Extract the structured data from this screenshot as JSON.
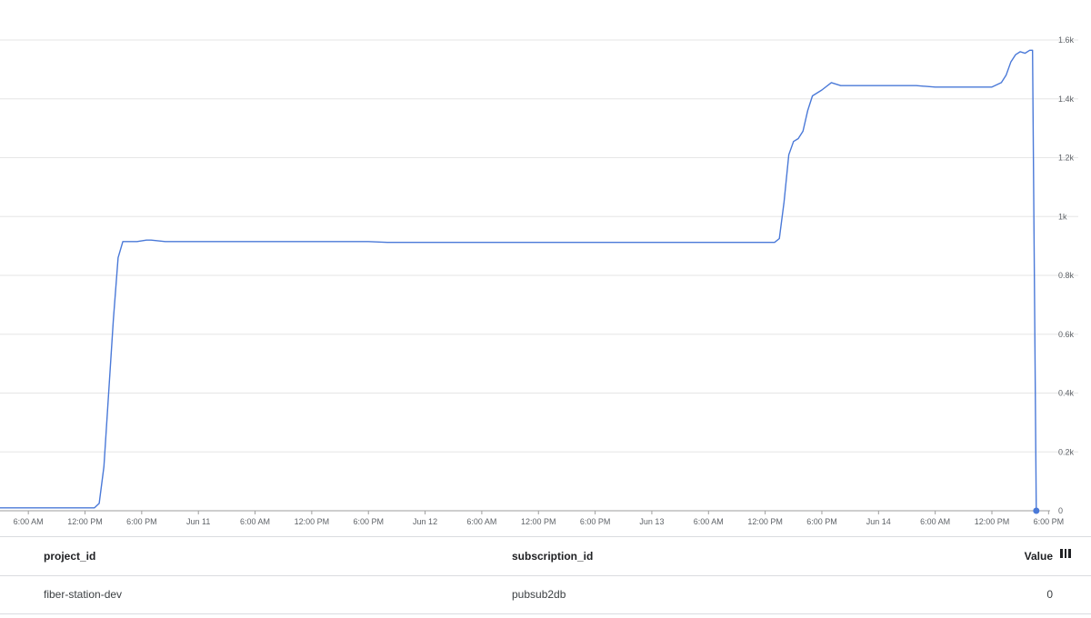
{
  "chart_data": {
    "type": "line",
    "title": "",
    "xlabel": "",
    "ylabel": "",
    "ylim": [
      0,
      1600
    ],
    "y_tick_labels": [
      "0",
      "0.2k",
      "0.4k",
      "0.6k",
      "0.8k",
      "1k",
      "1.2k",
      "1.4k",
      "1.6k"
    ],
    "y_tick_values": [
      0,
      200,
      400,
      600,
      800,
      1000,
      1200,
      1400,
      1600
    ],
    "x_unit": "hours",
    "xlim": [
      -21,
      63
    ],
    "x_ticks": [
      {
        "x": -18,
        "label": "6:00 AM"
      },
      {
        "x": -12,
        "label": "12:00 PM"
      },
      {
        "x": -6,
        "label": "6:00 PM"
      },
      {
        "x": 0,
        "label": "Jun 11"
      },
      {
        "x": 6,
        "label": "6:00 AM"
      },
      {
        "x": 12,
        "label": "12:00 PM"
      },
      {
        "x": 18,
        "label": "6:00 PM"
      },
      {
        "x": 24,
        "label": "Jun 12"
      },
      {
        "x": 30,
        "label": "6:00 AM"
      },
      {
        "x": 36,
        "label": "12:00 PM"
      },
      {
        "x": 42,
        "label": "6:00 PM"
      },
      {
        "x": 48,
        "label": "Jun 13"
      },
      {
        "x": 54,
        "label": "6:00 AM"
      },
      {
        "x": 60,
        "label": "12:00 PM"
      },
      {
        "x": 66,
        "label": "6:00 PM"
      },
      {
        "x": 72,
        "label": "Jun 14"
      },
      {
        "x": 78,
        "label": "6:00 AM"
      },
      {
        "x": 84,
        "label": "12:00 PM"
      },
      {
        "x": 90,
        "label": "6:00 PM"
      }
    ],
    "grid": true,
    "series": [
      {
        "color": "#4a79d8",
        "x": [
          -21,
          -11,
          -10.5,
          -10,
          -9.5,
          -9,
          -8.5,
          -8,
          -7.5,
          -6.5,
          -5.5,
          -5,
          -3.5,
          0,
          10,
          18,
          20,
          40,
          50,
          60,
          61,
          61.5,
          62,
          62.5,
          63,
          63.5,
          64,
          64.5,
          65,
          66,
          67,
          68,
          69,
          76,
          78,
          82,
          84,
          85,
          85.5,
          86,
          86.5,
          87,
          87.5,
          88,
          88.3,
          88.7
        ],
        "y": [
          10,
          10,
          25,
          150,
          400,
          650,
          860,
          915,
          915,
          915,
          920,
          920,
          915,
          915,
          915,
          915,
          912,
          912,
          912,
          912,
          912,
          925,
          1050,
          1210,
          1255,
          1265,
          1290,
          1360,
          1410,
          1430,
          1455,
          1445,
          1445,
          1445,
          1440,
          1440,
          1440,
          1455,
          1480,
          1525,
          1550,
          1560,
          1555,
          1565,
          1565,
          0
        ]
      }
    ]
  },
  "table": {
    "headers": {
      "project_id": "project_id",
      "subscription_id": "subscription_id",
      "value": "Value"
    },
    "rows": [
      {
        "project_id": "fiber-station-dev",
        "subscription_id": "pubsub2db",
        "value": "0"
      }
    ],
    "column_picker_icon": "columns-icon"
  }
}
